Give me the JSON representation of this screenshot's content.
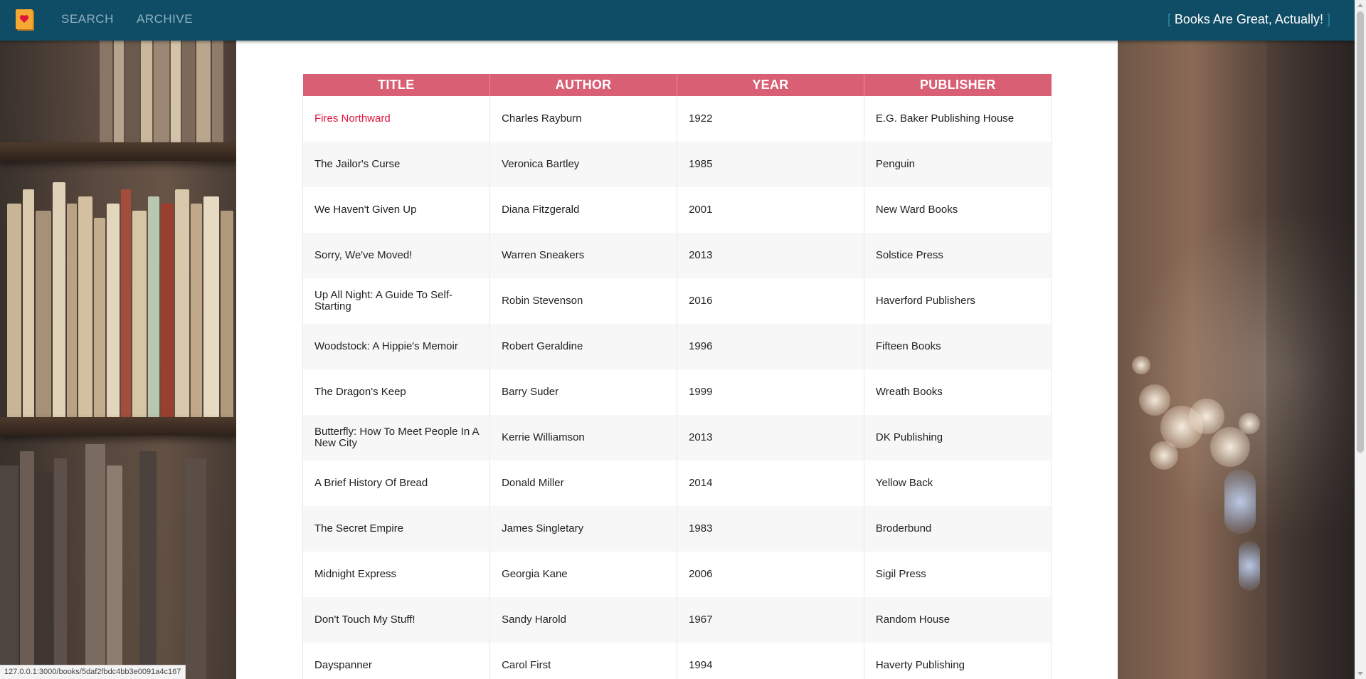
{
  "nav": {
    "search_label": "SEARCH",
    "archive_label": "ARCHIVE",
    "brand_open": "[",
    "brand_text": "Books Are Great, Actually!",
    "brand_close": "]"
  },
  "icons": {
    "logo": "heart-book-icon"
  },
  "colors": {
    "navbar": "#0f4c65",
    "table_header": "#d95f74",
    "link_hover": "#e0153d",
    "logo": "#f5a833"
  },
  "table": {
    "headers": [
      "TITLE",
      "AUTHOR",
      "YEAR",
      "PUBLISHER"
    ],
    "rows": [
      {
        "title": "Fires Northward",
        "author": "Charles Rayburn",
        "year": "1922",
        "publisher": "E.G. Baker Publishing House"
      },
      {
        "title": "The Jailor's Curse",
        "author": "Veronica Bartley",
        "year": "1985",
        "publisher": "Penguin"
      },
      {
        "title": "We Haven't Given Up",
        "author": "Diana Fitzgerald",
        "year": "2001",
        "publisher": "New Ward Books"
      },
      {
        "title": "Sorry, We've Moved!",
        "author": "Warren Sneakers",
        "year": "2013",
        "publisher": "Solstice Press"
      },
      {
        "title": "Up All Night: A Guide To Self-Starting",
        "author": "Robin Stevenson",
        "year": "2016",
        "publisher": "Haverford Publishers"
      },
      {
        "title": "Woodstock: A Hippie's Memoir",
        "author": "Robert Geraldine",
        "year": "1996",
        "publisher": "Fifteen Books"
      },
      {
        "title": "The Dragon's Keep",
        "author": "Barry Suder",
        "year": "1999",
        "publisher": "Wreath Books"
      },
      {
        "title": "Butterfly: How To Meet People In A New City",
        "author": "Kerrie Williamson",
        "year": "2013",
        "publisher": "DK Publishing"
      },
      {
        "title": "A Brief History Of Bread",
        "author": "Donald Miller",
        "year": "2014",
        "publisher": "Yellow Back"
      },
      {
        "title": "The Secret Empire",
        "author": "James Singletary",
        "year": "1983",
        "publisher": "Broderbund"
      },
      {
        "title": "Midnight Express",
        "author": "Georgia Kane",
        "year": "2006",
        "publisher": "Sigil Press"
      },
      {
        "title": "Don't Touch My Stuff!",
        "author": "Sandy Harold",
        "year": "1967",
        "publisher": "Random House"
      },
      {
        "title": "Dayspanner",
        "author": "Carol First",
        "year": "1994",
        "publisher": "Haverty Publishing"
      }
    ]
  },
  "status_url": "127.0.0.1:3000/books/5daf2fbdc4bb3e0091a4c167"
}
